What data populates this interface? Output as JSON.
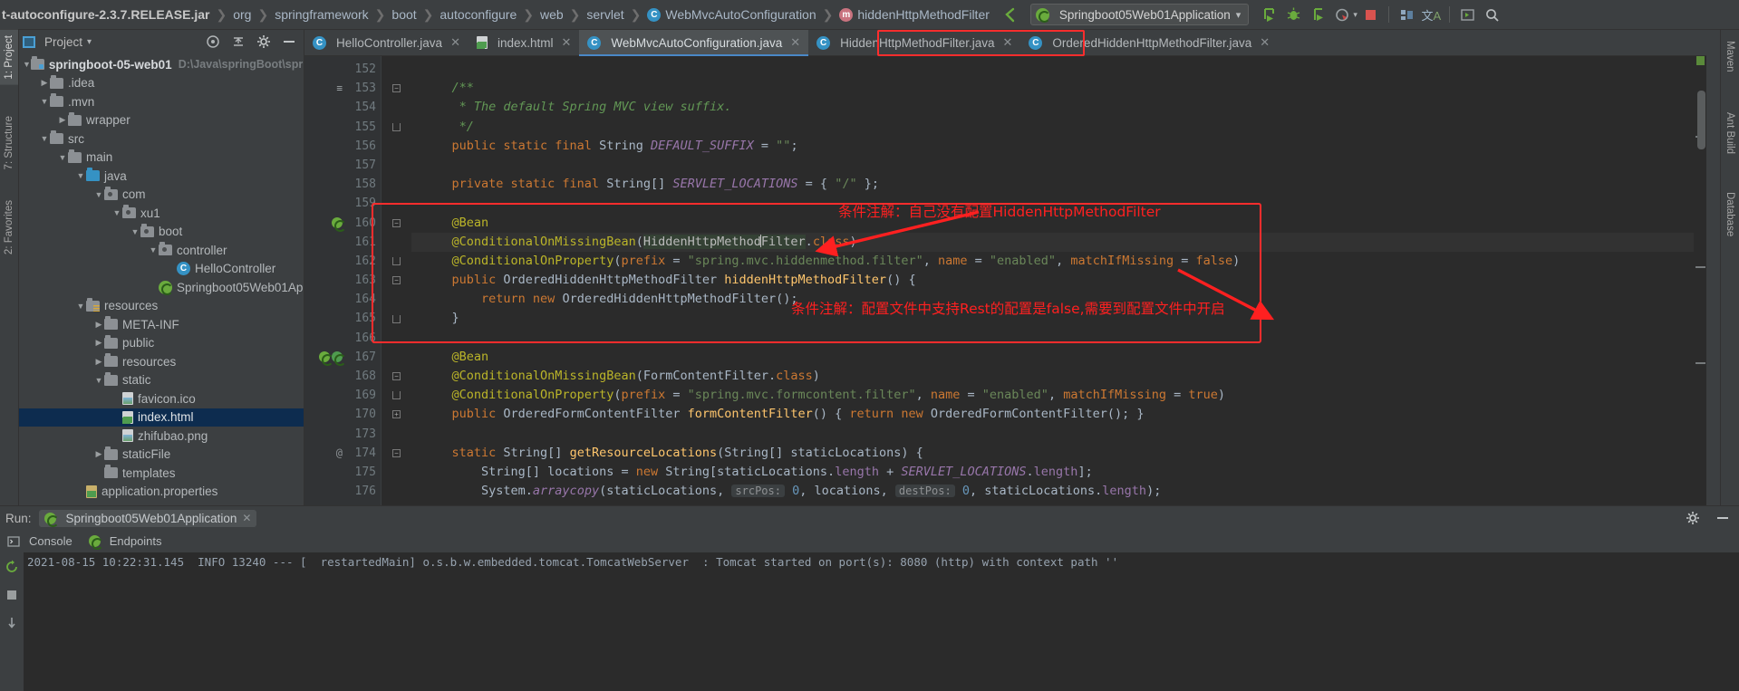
{
  "navbar": {
    "breadcrumbs": [
      {
        "label": "t-autoconfigure-2.3.7.RELEASE.jar",
        "icon": "",
        "bold": true
      },
      {
        "label": "org",
        "icon": ""
      },
      {
        "label": "springframework",
        "icon": ""
      },
      {
        "label": "boot",
        "icon": ""
      },
      {
        "label": "autoconfigure",
        "icon": ""
      },
      {
        "label": "web",
        "icon": ""
      },
      {
        "label": "servlet",
        "icon": ""
      },
      {
        "label": "WebMvcAutoConfiguration",
        "icon": "class-icon"
      },
      {
        "label": "hiddenHttpMethodFilter",
        "icon": "method-icon"
      }
    ],
    "separator": "❯",
    "back_icon": "back-arrow-icon",
    "run_config": {
      "name": "Springboot05Web01Application",
      "icon": "spring-boot-icon",
      "dropdown": "▾"
    },
    "buttons": [
      {
        "name": "run-button",
        "glyph": "▶"
      },
      {
        "name": "debug-button",
        "glyph": "🐞"
      },
      {
        "name": "run-coverage-button",
        "glyph": "▷"
      },
      {
        "name": "profiler-button",
        "glyph": "◔"
      },
      {
        "name": "stop-button",
        "glyph": "■"
      },
      {
        "name": "build-project-button",
        "glyph": "⚒"
      },
      {
        "name": "translate-button",
        "glyph": "文A"
      },
      {
        "name": "terminal-button",
        "glyph": "▸"
      },
      {
        "name": "search-everywhere-button",
        "glyph": "🔍"
      }
    ]
  },
  "left_strips": [
    {
      "label": "1: Project",
      "active": true
    },
    {
      "label": "7: Structure",
      "active": false
    },
    {
      "label": "2: Favorites",
      "active": false
    }
  ],
  "right_strips": [
    {
      "label": "Maven"
    },
    {
      "label": "Ant Build"
    },
    {
      "label": "Database"
    }
  ],
  "project_panel": {
    "header_title": "Project",
    "header_dropdown": "▾",
    "buttons": [
      {
        "name": "locate-in-tree-button",
        "glyph": "◉"
      },
      {
        "name": "collapse-all-button",
        "glyph": "⤓"
      },
      {
        "name": "settings-gear-button",
        "glyph": "⚙"
      },
      {
        "name": "hide-panel-button",
        "glyph": "—"
      }
    ],
    "tree": [
      {
        "depth": 0,
        "arrow": "▼",
        "icon": "module-folder-icon",
        "label": "springboot-05-web01",
        "suffix": "D:\\Java\\springBoot\\spri",
        "bold": true
      },
      {
        "depth": 1,
        "arrow": "▶",
        "icon": "folder-icon",
        "label": ".idea"
      },
      {
        "depth": 1,
        "arrow": "▼",
        "icon": "folder-icon",
        "label": ".mvn"
      },
      {
        "depth": 2,
        "arrow": "▶",
        "icon": "folder-icon",
        "label": "wrapper"
      },
      {
        "depth": 1,
        "arrow": "▼",
        "icon": "folder-icon",
        "label": "src"
      },
      {
        "depth": 2,
        "arrow": "▼",
        "icon": "folder-icon",
        "label": "main"
      },
      {
        "depth": 3,
        "arrow": "▼",
        "icon": "source-folder-icon",
        "label": "java"
      },
      {
        "depth": 4,
        "arrow": "▼",
        "icon": "package-icon",
        "label": "com"
      },
      {
        "depth": 5,
        "arrow": "▼",
        "icon": "package-icon",
        "label": "xu1"
      },
      {
        "depth": 6,
        "arrow": "▼",
        "icon": "package-icon",
        "label": "boot"
      },
      {
        "depth": 7,
        "arrow": "▼",
        "icon": "package-icon",
        "label": "controller"
      },
      {
        "depth": 8,
        "arrow": "",
        "icon": "class-icon",
        "label": "HelloController"
      },
      {
        "depth": 7,
        "arrow": "",
        "icon": "spring-boot-class-icon",
        "label": "Springboot05Web01App"
      },
      {
        "depth": 3,
        "arrow": "▼",
        "icon": "resources-folder-icon",
        "label": "resources"
      },
      {
        "depth": 4,
        "arrow": "▶",
        "icon": "folder-icon",
        "label": "META-INF"
      },
      {
        "depth": 4,
        "arrow": "▶",
        "icon": "folder-icon",
        "label": "public"
      },
      {
        "depth": 4,
        "arrow": "▶",
        "icon": "folder-icon",
        "label": "resources"
      },
      {
        "depth": 4,
        "arrow": "▼",
        "icon": "folder-icon",
        "label": "static"
      },
      {
        "depth": 5,
        "arrow": "",
        "icon": "image-file-icon",
        "label": "favicon.ico"
      },
      {
        "depth": 5,
        "arrow": "",
        "icon": "html-file-icon",
        "label": "index.html",
        "selected": true
      },
      {
        "depth": 5,
        "arrow": "",
        "icon": "image-file-icon",
        "label": "zhifubao.png"
      },
      {
        "depth": 4,
        "arrow": "▶",
        "icon": "folder-icon",
        "label": "staticFile"
      },
      {
        "depth": 4,
        "arrow": "",
        "icon": "folder-icon",
        "label": "templates"
      },
      {
        "depth": 3,
        "arrow": "",
        "icon": "properties-file-icon",
        "label": "application.properties"
      }
    ]
  },
  "editor": {
    "tabs": [
      {
        "label": "HelloController.java",
        "icon": "class-icon",
        "active": false,
        "close": "✕"
      },
      {
        "label": "index.html",
        "icon": "html-file-icon",
        "active": false,
        "close": "✕"
      },
      {
        "label": "WebMvcAutoConfiguration.java",
        "icon": "class-icon",
        "active": true,
        "close": "✕",
        "highlighted": true
      },
      {
        "label": "HiddenHttpMethodFilter.java",
        "icon": "class-icon",
        "active": false,
        "close": "✕"
      },
      {
        "label": "OrderedHiddenHttpMethodFilter.java",
        "icon": "class-icon",
        "active": false,
        "close": "✕"
      }
    ],
    "first_line_number": 152,
    "lines": [
      {
        "n": "152",
        "text": ""
      },
      {
        "n": "153",
        "text": "    /**"
      },
      {
        "n": "154",
        "text": "     * The default Spring MVC view suffix."
      },
      {
        "n": "155",
        "text": "     */"
      },
      {
        "n": "156",
        "text": "    public static final String DEFAULT_SUFFIX = \"\";"
      },
      {
        "n": "157",
        "text": ""
      },
      {
        "n": "158",
        "text": "    private static final String[] SERVLET_LOCATIONS = { \"/\" };"
      },
      {
        "n": "159",
        "text": ""
      },
      {
        "n": "160",
        "text": "    @Bean"
      },
      {
        "n": "161",
        "text": "    @ConditionalOnMissingBean(HiddenHttpMethodFilter.class)"
      },
      {
        "n": "162",
        "text": "    @ConditionalOnProperty(prefix = \"spring.mvc.hiddenmethod.filter\", name = \"enabled\", matchIfMissing = false)"
      },
      {
        "n": "163",
        "text": "    public OrderedHiddenHttpMethodFilter hiddenHttpMethodFilter() {"
      },
      {
        "n": "164",
        "text": "        return new OrderedHiddenHttpMethodFilter();"
      },
      {
        "n": "165",
        "text": "    }"
      },
      {
        "n": "166",
        "text": ""
      },
      {
        "n": "167",
        "text": "    @Bean"
      },
      {
        "n": "168",
        "text": "    @ConditionalOnMissingBean(FormContentFilter.class)"
      },
      {
        "n": "169",
        "text": "    @ConditionalOnProperty(prefix = \"spring.mvc.formcontent.filter\", name = \"enabled\", matchIfMissing = true)"
      },
      {
        "n": "170",
        "text": "    public OrderedFormContentFilter formContentFilter() { return new OrderedFormContentFilter(); }"
      },
      {
        "n": "173",
        "text": ""
      },
      {
        "n": "174",
        "text": "    static String[] getResourceLocations(String[] staticLocations) {"
      },
      {
        "n": "175",
        "text": "        String[] locations = new String[staticLocations.length + SERVLET_LOCATIONS.length];"
      },
      {
        "n": "176",
        "text": "        System.arraycopy(staticLocations, srcPos: 0, locations, destPos: 0, staticLocations.length);"
      }
    ],
    "inlay_hints": [
      "srcPos:",
      "destPos:"
    ]
  },
  "annotations": [
    {
      "name": "conditional-annotation-note-1",
      "text": "条件注解：自己没有配置HiddenHttpMethodFilter",
      "color": "#ff2020"
    },
    {
      "name": "conditional-annotation-note-2",
      "text": "条件注解：配置文件中支持Rest的配置是false,需要到配置文件中开启",
      "color": "#ff2020"
    }
  ],
  "run_panel": {
    "label": "Run:",
    "config_name": "Springboot05Web01Application",
    "config_close": "✕",
    "tabs": [
      {
        "label": "Console",
        "icon": "console-icon"
      },
      {
        "label": "Endpoints",
        "icon": "endpoints-icon"
      }
    ],
    "side_buttons": [
      {
        "name": "rerun-button",
        "glyph": "↻"
      },
      {
        "name": "stop-run-button",
        "glyph": "■"
      },
      {
        "name": "trace-button",
        "glyph": "↓"
      }
    ],
    "header_right": [
      {
        "name": "run-settings-gear",
        "glyph": "⚙"
      },
      {
        "name": "hide-run-panel",
        "glyph": "—"
      }
    ],
    "console_lines": [
      "2021-08-15 10:22:31.145  INFO 13240 --- [  restartedMain] o.s.b.w.embedded.tomcat.TomcatWebServer  : Tomcat started on port(s): 8080 (http) with context path ''"
    ]
  },
  "colors": {
    "accent": "#4a88c7",
    "annotation_red": "#ff2020",
    "editor_bg": "#2b2b2b",
    "panel_bg": "#3c3f41",
    "selection_blue": "#0d2c4f"
  }
}
